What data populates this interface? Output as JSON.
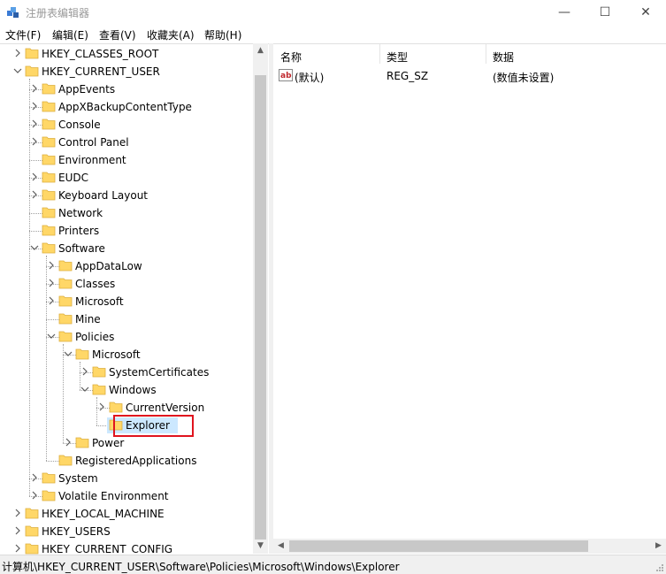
{
  "window": {
    "title": "注册表编辑器",
    "minimize": "—",
    "maximize": "☐",
    "close": "✕"
  },
  "menu": [
    "文件(F)",
    "编辑(E)",
    "查看(V)",
    "收藏夹(A)",
    "帮助(H)"
  ],
  "tree": [
    {
      "label": "HKEY_CLASSES_ROOT",
      "level": 1,
      "state": "collapsed"
    },
    {
      "label": "HKEY_CURRENT_USER",
      "level": 1,
      "state": "expanded"
    },
    {
      "label": "AppEvents",
      "level": 2,
      "state": "collapsed"
    },
    {
      "label": "AppXBackupContentType",
      "level": 2,
      "state": "collapsed"
    },
    {
      "label": "Console",
      "level": 2,
      "state": "collapsed"
    },
    {
      "label": "Control Panel",
      "level": 2,
      "state": "collapsed"
    },
    {
      "label": "Environment",
      "level": 2,
      "state": "leaf"
    },
    {
      "label": "EUDC",
      "level": 2,
      "state": "collapsed"
    },
    {
      "label": "Keyboard Layout",
      "level": 2,
      "state": "collapsed"
    },
    {
      "label": "Network",
      "level": 2,
      "state": "leaf"
    },
    {
      "label": "Printers",
      "level": 2,
      "state": "leaf"
    },
    {
      "label": "Software",
      "level": 2,
      "state": "expanded"
    },
    {
      "label": "AppDataLow",
      "level": 3,
      "state": "collapsed"
    },
    {
      "label": "Classes",
      "level": 3,
      "state": "collapsed"
    },
    {
      "label": "Microsoft",
      "level": 3,
      "state": "collapsed"
    },
    {
      "label": "Mine",
      "level": 3,
      "state": "leaf"
    },
    {
      "label": "Policies",
      "level": 3,
      "state": "expanded"
    },
    {
      "label": "Microsoft",
      "level": 4,
      "state": "expanded"
    },
    {
      "label": "SystemCertificates",
      "level": 5,
      "state": "collapsed"
    },
    {
      "label": "Windows",
      "level": 5,
      "state": "expanded"
    },
    {
      "label": "CurrentVersion",
      "level": 6,
      "state": "collapsed"
    },
    {
      "label": "Explorer",
      "level": 6,
      "state": "leaf",
      "selected": true
    },
    {
      "label": "Power",
      "level": 4,
      "state": "collapsed"
    },
    {
      "label": "RegisteredApplications",
      "level": 3,
      "state": "leaf"
    },
    {
      "label": "System",
      "level": 2,
      "state": "collapsed"
    },
    {
      "label": "Volatile Environment",
      "level": 2,
      "state": "collapsed"
    },
    {
      "label": "HKEY_LOCAL_MACHINE",
      "level": 1,
      "state": "collapsed"
    },
    {
      "label": "HKEY_USERS",
      "level": 1,
      "state": "collapsed"
    },
    {
      "label": "HKEY_CURRENT_CONFIG",
      "level": 1,
      "state": "collapsed"
    }
  ],
  "list": {
    "columns": [
      "名称",
      "类型",
      "数据"
    ],
    "rows": [
      {
        "name": "(默认)",
        "type": "REG_SZ",
        "data": "(数值未设置)"
      }
    ]
  },
  "status": {
    "path": "计算机\\HKEY_CURRENT_USER\\Software\\Policies\\Microsoft\\Windows\\Explorer"
  },
  "colors": {
    "folder": "#ffd767",
    "folder_edge": "#dcae3e",
    "highlight": "#e0141e",
    "selection": "#cce8ff"
  }
}
